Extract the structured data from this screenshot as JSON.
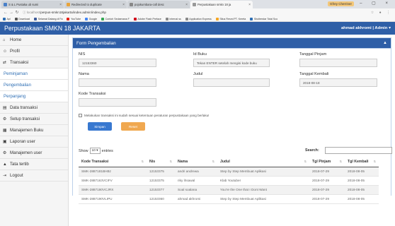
{
  "browser": {
    "tabs": [
      {
        "label": "S & L Pustaka ub sumi"
      },
      {
        "label": "Redirected to duplicate"
      },
      {
        "label": "pojokumbara-coll desc"
      },
      {
        "label": "Perpustakaan smkn 18 ja"
      }
    ],
    "window_user": "Gfrey Cherriner",
    "url_scheme": "ⓘ localhost/",
    "url_path": "perpus-smkn18jakarta/index.admin/index.php",
    "bookmarks": [
      {
        "label": "Apl",
        "color": "#2f6fb4"
      },
      {
        "label": "Download",
        "color": "#555555"
      },
      {
        "label": "Selamat Datang di Fa",
        "color": "#3b5998"
      },
      {
        "label": "YouTube",
        "color": "#e62117"
      },
      {
        "label": "Google",
        "color": "#4285f4"
      },
      {
        "label": "Contoh Sedaenana F",
        "color": "#34a853"
      },
      {
        "label": "Adobe Flash Preface",
        "color": "#d0021b"
      },
      {
        "label": "internal ss",
        "color": "#888888"
      },
      {
        "label": "Application Express",
        "color": "#888888"
      },
      {
        "label": "Situs Resmi PT. Kereta",
        "color": "#f5a623"
      },
      {
        "label": "Shutterstar Total Sco",
        "color": "#2f6fb4"
      }
    ]
  },
  "topbar": {
    "brand": "Perpustakaan SMKN 18 JAKARTA",
    "user": "ahmad akhromi | Admin"
  },
  "sidebar": {
    "items": [
      {
        "label": "Home",
        "icon": "⌂",
        "sub": false
      },
      {
        "label": "Profil",
        "icon": "☺",
        "sub": false
      },
      {
        "label": "Transaksi",
        "icon": "⇄",
        "sub": false
      },
      {
        "label": "Peminjaman",
        "icon": "",
        "sub": true
      },
      {
        "label": "Pengembalian",
        "icon": "",
        "sub": true
      },
      {
        "label": "Perpanjang",
        "icon": "",
        "sub": true
      },
      {
        "label": "Data transaksi",
        "icon": "▤",
        "sub": false
      },
      {
        "label": "Setup transaksi",
        "icon": "⚙",
        "sub": false
      },
      {
        "label": "Manajemen Buku",
        "icon": "▦",
        "sub": false
      },
      {
        "label": "Laporan user",
        "icon": "▣",
        "sub": false
      },
      {
        "label": "Manajemen user",
        "icon": "⚙",
        "sub": false
      },
      {
        "label": "Tata tertib",
        "icon": "▲",
        "sub": false
      },
      {
        "label": "Logout",
        "icon": "⇥",
        "sub": false
      }
    ]
  },
  "panel": {
    "title": "Form Pengembalian",
    "collapse_icon": "▲"
  },
  "form": {
    "nis_label": "NIS",
    "nis_value": "12153360",
    "id_buku_label": "Id Buku",
    "id_buku_placeholder": "Tekan ENTER setelah mengisi kode buku",
    "tgl_pinjam_label": "Tanggal Pinjam",
    "nama_label": "Nama",
    "judul_label": "Judul",
    "tgl_kembali_label": "Tanggal Kembali",
    "tgl_kembali_value": "2018-08-18",
    "kode_label": "Kode Transaksi",
    "checkbox_text": "Melakukan transaksi ini sudah sesuai ketentuan peraturan perpustakaan yang berlaku!",
    "save_label": "Simpan",
    "reset_label": "Reset"
  },
  "table": {
    "show_label": "Show",
    "show_value": "10",
    "entries_label": "entries",
    "search_label": "Search:",
    "headers": [
      "Kode Transaksi",
      "Nis",
      "Nama",
      "Judul",
      "Tgl Pinjam",
      "Tgl Kembali"
    ],
    "rows": [
      [
        "SMK-2887181BHBz",
        "12153375",
        "andri andrewa",
        "Step by Step Membuat Aplikasi",
        "2018-07-29",
        "2018-08-05"
      ],
      [
        "SMK-2887163VCIFV",
        "12153375",
        "riky ihsawal",
        "Klab Youtuber",
        "2018-07-29",
        "2018-08-05"
      ],
      [
        "SMK-2887180VCJRX",
        "12153377",
        "Soal soalana",
        "You're the One that I Dont Want",
        "2018-07-29",
        "2018-08-05"
      ],
      [
        "SMK-2887190VLIPU",
        "12153360",
        "ahmad akhromi",
        "Step by Step Membuat Aplikasi",
        "2018-07-29",
        "2018-08-05"
      ]
    ]
  }
}
